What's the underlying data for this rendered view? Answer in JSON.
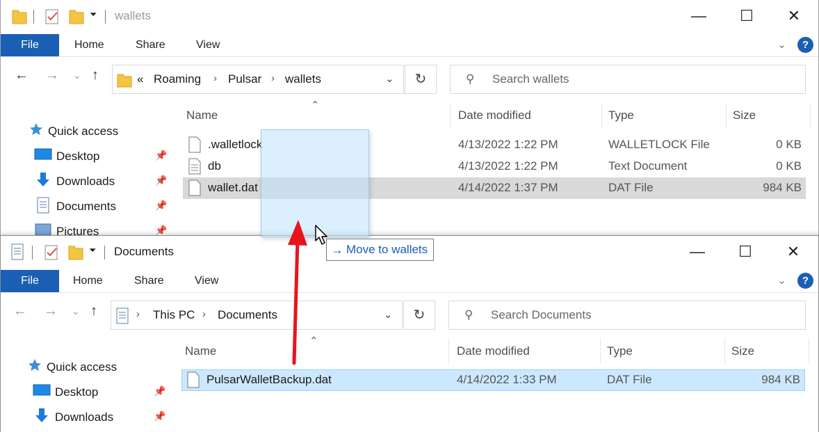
{
  "top_window": {
    "title": "wallets",
    "ribbon_tabs": [
      "File",
      "Home",
      "Share",
      "View"
    ],
    "breadcrumb": [
      "«",
      "Roaming",
      "Pulsar",
      "wallets"
    ],
    "search_placeholder": "Search wallets",
    "nav_items": [
      {
        "label": "Quick access",
        "icon": "star-icon"
      },
      {
        "label": "Desktop",
        "icon": "desktop-icon"
      },
      {
        "label": "Downloads",
        "icon": "download-icon"
      },
      {
        "label": "Documents",
        "icon": "document-icon"
      },
      {
        "label": "Pictures",
        "icon": "pictures-icon"
      }
    ],
    "columns": [
      "Name",
      "Date modified",
      "Type",
      "Size"
    ],
    "files": [
      {
        "name": ".walletlock",
        "date": "4/13/2022 1:22 PM",
        "type": "WALLETLOCK File",
        "size": "0 KB"
      },
      {
        "name": "db",
        "date": "4/13/2022 1:22 PM",
        "type": "Text Document",
        "size": "0 KB"
      },
      {
        "name": "wallet.dat",
        "date": "4/14/2022 1:37 PM",
        "type": "DAT File",
        "size": "984 KB"
      }
    ]
  },
  "bottom_window": {
    "title": "Documents",
    "ribbon_tabs": [
      "File",
      "Home",
      "Share",
      "View"
    ],
    "breadcrumb": [
      "This PC",
      "Documents"
    ],
    "search_placeholder": "Search Documents",
    "nav_items": [
      {
        "label": "Quick access",
        "icon": "star-icon"
      },
      {
        "label": "Desktop",
        "icon": "desktop-icon"
      },
      {
        "label": "Downloads",
        "icon": "download-icon"
      }
    ],
    "columns": [
      "Name",
      "Date modified",
      "Type",
      "Size"
    ],
    "files": [
      {
        "name": "PulsarWalletBackup.dat",
        "date": "4/14/2022 1:33 PM",
        "type": "DAT File",
        "size": "984 KB"
      }
    ]
  },
  "drag_tooltip": "Move to wallets",
  "colors": {
    "accent": "#1a5fb4",
    "selection_blue": "#cce8ff",
    "selection_gray": "#d9d9d9",
    "arrow_red": "#e8141b"
  }
}
